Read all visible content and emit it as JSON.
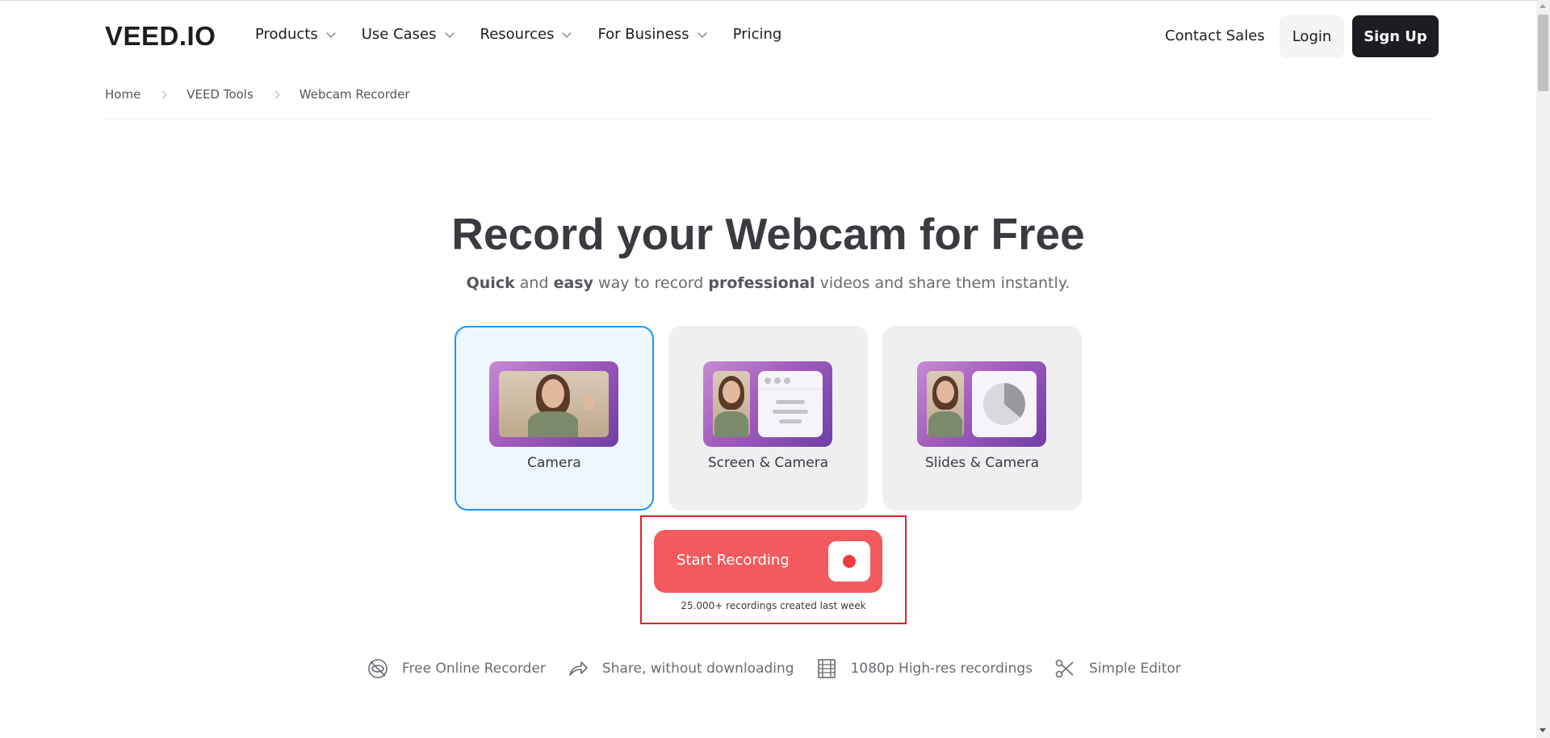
{
  "nav": {
    "logo": "VEED.IO",
    "menu": [
      {
        "label": "Products",
        "has_dropdown": true
      },
      {
        "label": "Use Cases",
        "has_dropdown": true
      },
      {
        "label": "Resources",
        "has_dropdown": true
      },
      {
        "label": "For Business",
        "has_dropdown": true
      },
      {
        "label": "Pricing",
        "has_dropdown": false
      }
    ],
    "contact": "Contact Sales",
    "login": "Login",
    "signup": "Sign Up"
  },
  "breadcrumb": [
    "Home",
    "VEED Tools",
    "Webcam Recorder"
  ],
  "hero": {
    "title": "Record your Webcam for Free",
    "subtitle_parts": {
      "p1": "Quick",
      "p2": " and ",
      "p3": "easy",
      "p4": " way to record ",
      "p5": "professional",
      "p6": " videos and share them instantly."
    }
  },
  "modes": [
    {
      "label": "Camera",
      "selected": true
    },
    {
      "label": "Screen & Camera",
      "selected": false
    },
    {
      "label": "Slides & Camera",
      "selected": false
    }
  ],
  "record": {
    "label": "Start Recording",
    "note": "25.000+ recordings created last week"
  },
  "features": [
    {
      "icon": "eye-off-icon",
      "label": "Free Online Recorder"
    },
    {
      "icon": "share-arrow-icon",
      "label": "Share, without downloading"
    },
    {
      "icon": "film-icon",
      "label": "1080p High-res recordings"
    },
    {
      "icon": "scissors-icon",
      "label": "Simple Editor"
    }
  ],
  "colors": {
    "accent": "#2196f3",
    "record": "#f25a5e",
    "dark": "#1c1c22"
  }
}
